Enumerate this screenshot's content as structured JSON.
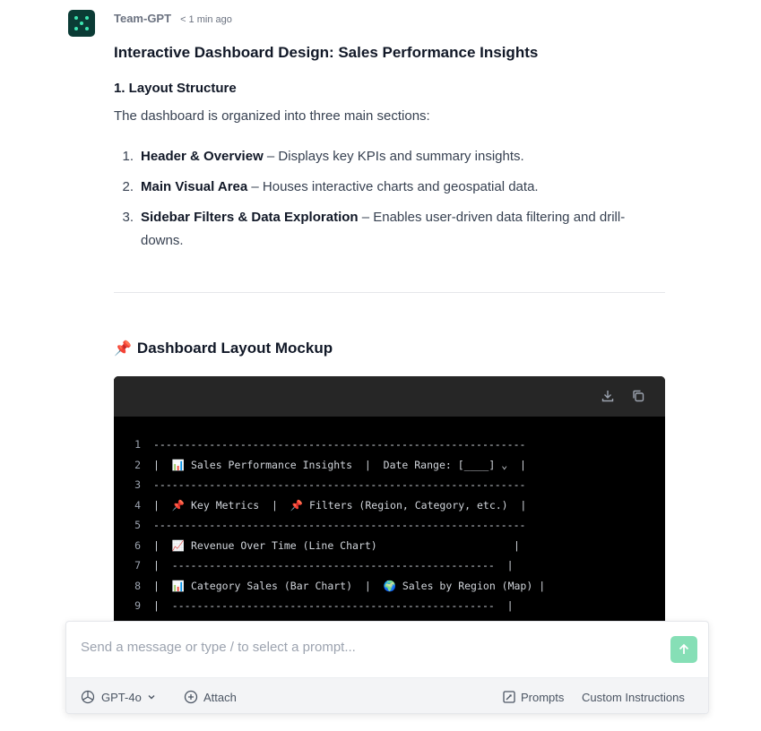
{
  "message": {
    "author": "Team-GPT",
    "time": "< 1 min ago",
    "title": "Interactive Dashboard Design: Sales Performance Insights",
    "section1_heading": "1. Layout Structure",
    "intro": "The dashboard is organized into three main sections:",
    "list": [
      {
        "num": "1.",
        "bold": "Header & Overview",
        "rest": " – Displays key KPIs and summary insights."
      },
      {
        "num": "2.",
        "bold": "Main Visual Area",
        "rest": " – Houses interactive charts and geospatial data."
      },
      {
        "num": "3.",
        "bold": "Sidebar Filters & Data Exploration",
        "rest": " – Enables user-driven data filtering and drill-downs."
      }
    ],
    "mockup_heading": "Dashboard Layout Mockup",
    "mockup_icon": "📌"
  },
  "code": {
    "icons": [
      "download-icon",
      "copy-icon"
    ],
    "lines": [
      {
        "n": "1",
        "t": "------------------------------------------------------------"
      },
      {
        "n": "2",
        "t": "|  📊 Sales Performance Insights  |  Date Range: [____] ⌄  |"
      },
      {
        "n": "3",
        "t": "------------------------------------------------------------"
      },
      {
        "n": "4",
        "t": "|  📌 Key Metrics  |  📌 Filters (Region, Category, etc.)  |"
      },
      {
        "n": "5",
        "t": "------------------------------------------------------------"
      },
      {
        "n": "6",
        "t": "|  📈 Revenue Over Time (Line Chart)                      |"
      },
      {
        "n": "7",
        "t": "|  ----------------------------------------------------  |"
      },
      {
        "n": "8",
        "t": "|  📊 Category Sales (Bar Chart)  |  🌍 Sales by Region (Map) |"
      },
      {
        "n": "9",
        "t": "|  ----------------------------------------------------  |"
      }
    ]
  },
  "composer": {
    "placeholder": "Send a message or type / to select a prompt...",
    "model": "GPT-4o",
    "attach": "Attach",
    "prompts": "Prompts",
    "custom_instructions": "Custom Instructions"
  },
  "colors": {
    "avatar_bg": "#0b3b35",
    "avatar_dots": "#3ee6b3",
    "send_button": "#86dfb6"
  }
}
